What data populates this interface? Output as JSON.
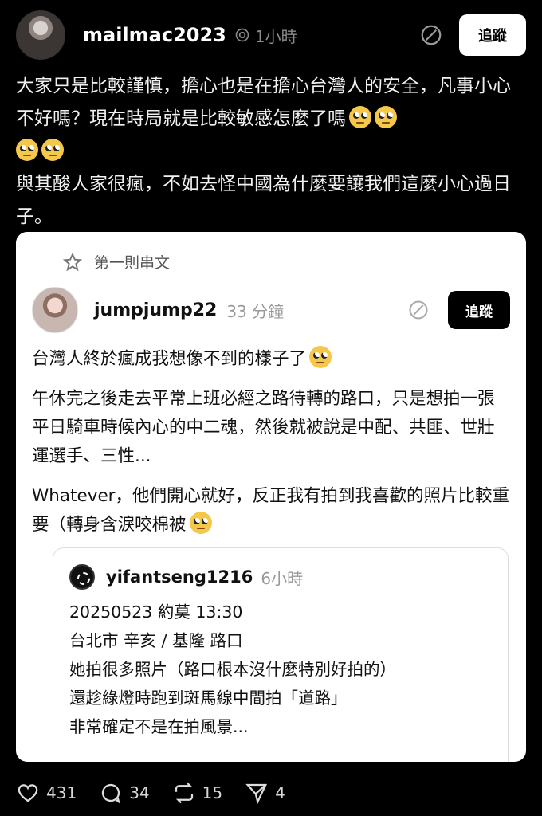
{
  "post": {
    "username": "mailmac2023",
    "time": "1小時",
    "follow_label": "追蹤",
    "paragraphs": [
      "大家只是比較謹慎，擔心也是在擔心台灣人的安全，凡事小心不好嗎？現在時局就是比較敏感怎麼了嗎",
      "與其酸人家很瘋，不如去怪中國為什麼要讓我們這麼小心過日子。"
    ],
    "emoji": "face-with-rolling-eyes"
  },
  "quoted": {
    "label": "第一則串文",
    "username": "jumpjump22",
    "time": "33 分鐘",
    "follow_label": "追蹤",
    "paragraphs": [
      "台灣人終於瘋成我想像不到的樣子了",
      "午休完之後走去平常上班必經之路待轉的路口，只是想拍一張平日騎車時候內心的中二魂，然後就被說是中配、共匪、世壯運選手、三性...",
      "Whatever，他們開心就好，反正我有拍到我喜歡的照片比較重要（轉身含淚咬棉被"
    ]
  },
  "nested": {
    "username": "yifantseng1216",
    "time": "6小時",
    "lines": [
      "20250523 約莫 13:30",
      "台北市 辛亥 / 基隆 路口",
      "她拍很多照片（路口根本沒什麼特別好拍的）",
      "還趁綠燈時跑到斑馬線中間拍「道路」",
      "非常確定不是在拍風景..."
    ]
  },
  "actions": {
    "likes": "431",
    "comments": "34",
    "reposts": "15",
    "shares": "4"
  }
}
